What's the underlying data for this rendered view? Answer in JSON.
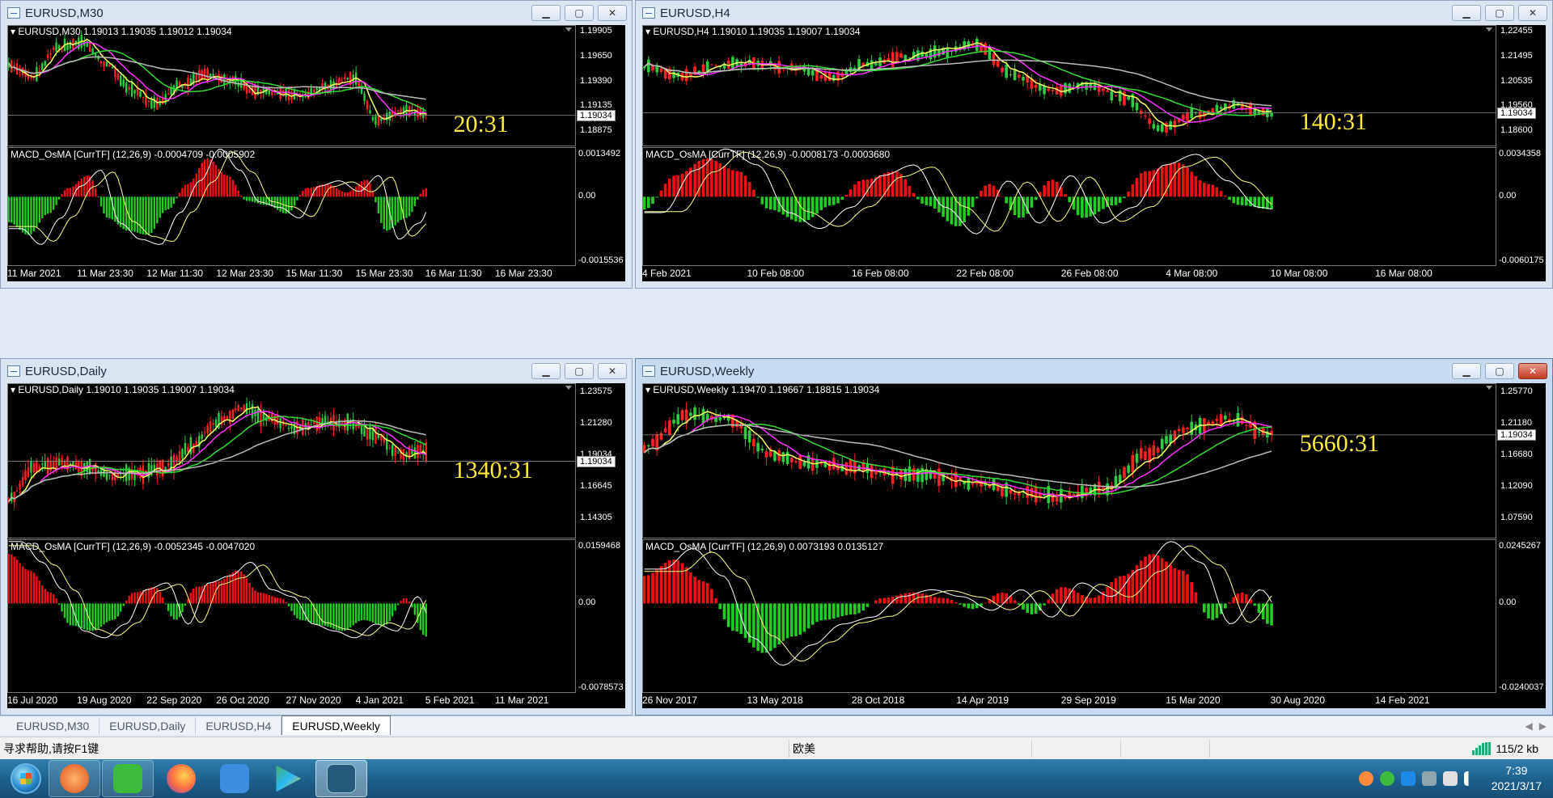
{
  "windows": [
    {
      "id": "m30",
      "title": "EURUSD,M30",
      "active": false,
      "chart_header": "EURUSD,M30  1.19013 1.19035 1.19012 1.19034",
      "timer": "20:31",
      "price_axis": [
        "1.19905",
        "1.19650",
        "1.19390",
        "1.19135",
        "1.18875"
      ],
      "current_price": "1.19034",
      "osc_header": "MACD_OsMA [CurrTF] (12,26,9) -0.0004709 -0.0005902",
      "osc_axis": [
        "0.0013492",
        "0.00",
        "-0.0015536"
      ],
      "x_axis": [
        "11 Mar 2021",
        "11 Mar 23:30",
        "12 Mar 11:30",
        "12 Mar 23:30",
        "15 Mar 11:30",
        "15 Mar 23:30",
        "16 Mar 11:30",
        "16 Mar 23:30"
      ]
    },
    {
      "id": "h4",
      "title": "EURUSD,H4",
      "active": false,
      "chart_header": "EURUSD,H4  1.19010 1.19035 1.19007 1.19034",
      "timer": "140:31",
      "price_axis": [
        "1.22455",
        "1.21495",
        "1.20535",
        "1.19560",
        "1.18600"
      ],
      "current_price": "1.19034",
      "osc_header": "MACD_OsMA [CurrTF] (12,26,9) -0.0008173 -0.0003680",
      "osc_axis": [
        "0.0034358",
        "0.00",
        "-0.0060175"
      ],
      "x_axis": [
        "4 Feb 2021",
        "10 Feb 08:00",
        "16 Feb 08:00",
        "22 Feb 08:00",
        "26 Feb 08:00",
        "4 Mar 08:00",
        "10 Mar 08:00",
        "16 Mar 08:00"
      ]
    },
    {
      "id": "daily",
      "title": "EURUSD,Daily",
      "active": false,
      "chart_header": "EURUSD,Daily  1.19010 1.19035 1.19007 1.19034",
      "timer": "1340:31",
      "price_axis": [
        "1.23575",
        "1.21280",
        "1.19034",
        "1.16645",
        "1.14305"
      ],
      "current_price": "1.19034",
      "osc_header": "MACD_OsMA [CurrTF] (12,26,9) -0.0052345 -0.0047020",
      "osc_axis": [
        "0.0159468",
        "0.00",
        "-0.0078573"
      ],
      "x_axis": [
        "16 Jul 2020",
        "19 Aug 2020",
        "22 Sep 2020",
        "26 Oct 2020",
        "27 Nov 2020",
        "4 Jan 2021",
        "5 Feb 2021",
        "11 Mar 2021"
      ]
    },
    {
      "id": "weekly",
      "title": "EURUSD,Weekly",
      "active": true,
      "chart_header": "EURUSD,Weekly  1.19470 1.19667 1.18815 1.19034",
      "timer": "5660:31",
      "price_axis": [
        "1.25770",
        "1.21180",
        "1.16680",
        "1.12090",
        "1.07590"
      ],
      "current_price": "1.19034",
      "osc_header": "MACD_OsMA [CurrTF] (12,26,9) 0.0073193 0.0135127",
      "osc_axis": [
        "0.0245267",
        "0.00",
        "-0.0240037"
      ],
      "x_axis": [
        "26 Nov 2017",
        "13 May 2018",
        "28 Oct 2018",
        "14 Apr 2019",
        "29 Sep 2019",
        "15 Mar 2020",
        "30 Aug 2020",
        "14 Feb 2021"
      ]
    }
  ],
  "tabs": [
    "EURUSD,M30",
    "EURUSD,Daily",
    "EURUSD,H4",
    "EURUSD,Weekly"
  ],
  "active_tab": "EURUSD,Weekly",
  "status": {
    "help": "寻求帮助,请按F1键",
    "profile": "欧美",
    "connection": "115/2 kb"
  },
  "clock": {
    "time": "7:39",
    "date": "2021/3/17"
  },
  "colors": {
    "bull_candle": "#2ecc40",
    "bear_candle": "#ff2222",
    "ma_fast": "#ffff66",
    "ma_mid": "#ff33ff",
    "ma_slow": "#33dd33",
    "ma_long": "#bbbbbb",
    "timer": "#ffeb3b",
    "hist_up": "#ee1111",
    "hist_down": "#22cc22"
  },
  "taskbar_icons": [
    "start-orb",
    "app-orange-icon",
    "wechat-icon",
    "firefox-icon",
    "note-app-icon",
    "video-player-icon",
    "trading-terminal-icon"
  ]
}
